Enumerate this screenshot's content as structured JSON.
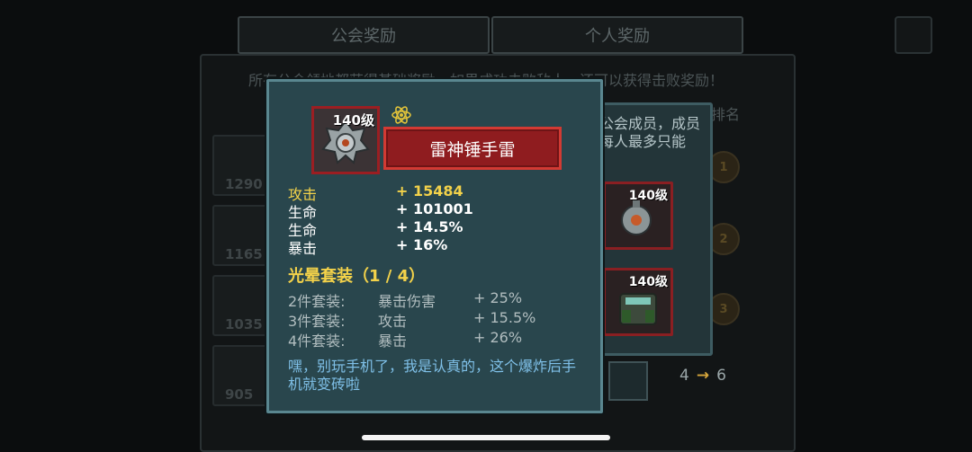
{
  "tabs": {
    "guild_rewards": "公会奖励",
    "personal_rewards": "个人奖励"
  },
  "background": {
    "banner_text": "所有公会领地都获得基础奖励，如果成功击败敌人，还可以获得击败奖励！",
    "rank_label": "排名",
    "row_numbers": [
      "1290",
      "1165",
      "1035",
      "905"
    ],
    "medals": [
      "1",
      "2",
      "3"
    ]
  },
  "side_dialog": {
    "text": "公会成员，成员每人最多只能",
    "items": [
      {
        "level": "140级"
      },
      {
        "level": "140级"
      }
    ],
    "upgrade_from": "4",
    "upgrade_to": "6",
    "arrow": "→"
  },
  "tooltip": {
    "item_level": "140级",
    "item_name": "雷神锤手雷",
    "rarity_icon": "atom-icon",
    "stats": [
      {
        "label": "攻击",
        "value": "+ 15484",
        "highlight": true
      },
      {
        "label": "生命",
        "value": "+ 101001",
        "highlight": false
      },
      {
        "label": "生命",
        "value": "+ 14.5%",
        "highlight": false
      },
      {
        "label": "暴击",
        "value": "+ 16%",
        "highlight": false
      }
    ],
    "set_title": "光晕套装（1 / 4）",
    "set_bonuses": [
      {
        "pieces": "2件套装:",
        "stat": "暴击伤害",
        "value": "+ 25%"
      },
      {
        "pieces": "3件套装:",
        "stat": "攻击",
        "value": "+ 15.5%"
      },
      {
        "pieces": "4件套装:",
        "stat": "暴击",
        "value": "+ 26%"
      }
    ],
    "flavor_text": "嘿，别玩手机了，我是认真的，这个爆炸后手机就变砖啦"
  },
  "colors": {
    "tooltip_bg": "#29464d",
    "accent_red": "#9b1e22",
    "gold": "#f3d24a",
    "flavor_blue": "#7fc0e8"
  }
}
